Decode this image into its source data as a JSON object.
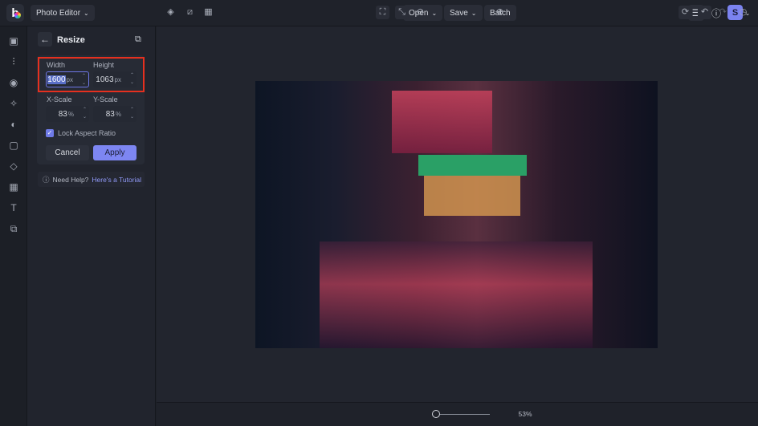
{
  "topbar": {
    "logo": "b",
    "mode": "Photo Editor",
    "open": "Open",
    "save": "Save",
    "batch": "Batch",
    "avatar": "S"
  },
  "panel": {
    "title": "Resize",
    "width_label": "Width",
    "height_label": "Height",
    "width_value": "1600",
    "height_value": "1063",
    "unit": "px",
    "xscale_label": "X-Scale",
    "yscale_label": "Y-Scale",
    "xscale_value": "83",
    "yscale_value": "83",
    "pct": "%",
    "lock_label": "Lock Aspect Ratio",
    "lock_checked": true,
    "cancel": "Cancel",
    "apply": "Apply",
    "help_text": "Need Help?",
    "help_link": "Here's a Tutorial"
  },
  "bottombar": {
    "zoom": "53%",
    "zoom_fraction": 0.0
  },
  "colors": {
    "accent": "#7d86f2",
    "highlight": "#e5301f"
  }
}
